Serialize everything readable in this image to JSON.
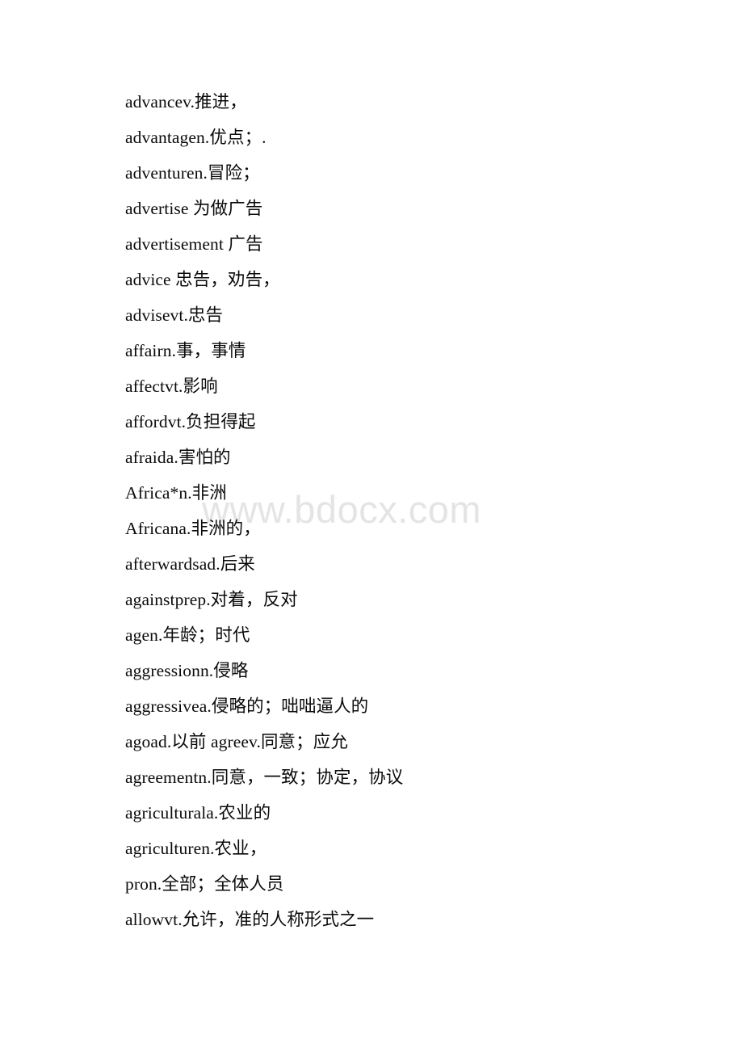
{
  "document": {
    "page_background": "#ffffff",
    "text_color": "#0b0b0b",
    "watermark": {
      "text": "www.bdocx.com",
      "color": "#e4e4e4"
    },
    "lines": [
      {
        "text": "advancev.推进，"
      },
      {
        "text": "advantagen.优点；."
      },
      {
        "text": "adventuren.冒险；"
      },
      {
        "text": "advertise 为做广告"
      },
      {
        "text": "advertisement 广告"
      },
      {
        "text": "advice 忠告，劝告，"
      },
      {
        "text": "advisevt.忠告"
      },
      {
        "text": "affairn.事，事情"
      },
      {
        "text": "affectvt.影响"
      },
      {
        "text": "affordvt.负担得起"
      },
      {
        "text": "afraida.害怕的"
      },
      {
        "text": "Africa*n.非洲"
      },
      {
        "text": "Africana.非洲的，"
      },
      {
        "text": "afterwardsad.后来"
      },
      {
        "text": "againstprep.对着，反对"
      },
      {
        "text": "agen.年龄；时代"
      },
      {
        "text": "aggressionn.侵略"
      },
      {
        "text": "aggressivea.侵略的；咄咄逼人的"
      },
      {
        "text": "agoad.以前 agreev.同意；应允"
      },
      {
        "text": "agreementn.同意，一致；协定，协议"
      },
      {
        "text": "agriculturala.农业的"
      },
      {
        "text": "agriculturen.农业，"
      },
      {
        "text": "pron.全部；全体人员"
      },
      {
        "text": "allowvt.允许，准的人称形式之一"
      }
    ]
  }
}
